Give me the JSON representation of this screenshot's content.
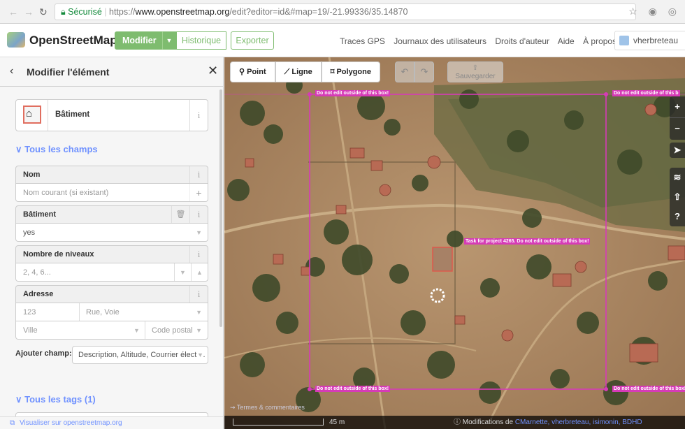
{
  "browser": {
    "security_label": "Sécurisé",
    "url_scheme": "https://",
    "url_host": "www.openstreetmap.org",
    "url_path": "/edit?editor=id&#map=19/-21.99336/35.14870"
  },
  "osm_header": {
    "brand": "OpenStreetMap",
    "modifier_label": "Modifier",
    "historique_label": "Historique",
    "exporter_label": "Exporter",
    "links": [
      "Traces GPS",
      "Journaux des utilisateurs",
      "Droits d'auteur",
      "Aide",
      "À propos"
    ],
    "username": "vherbreteau"
  },
  "panel": {
    "title": "Modifier l'élément",
    "preset_name": "Bâtiment",
    "section_fields": "Tous les champs",
    "fields": {
      "nom_label": "Nom",
      "nom_placeholder": "Nom courant (si existant)",
      "batiment_label": "Bâtiment",
      "batiment_value": "yes",
      "niveaux_label": "Nombre de niveaux",
      "niveaux_placeholder": "2, 4, 6...",
      "adresse_label": "Adresse",
      "adresse_number": "123",
      "adresse_street": "Rue, Voie",
      "adresse_city": "Ville",
      "adresse_postcode": "Code postal"
    },
    "add_field_label": "Ajouter champ:",
    "add_field_value": "Description, Altitude, Courrier électr...",
    "section_tags": "Tous les tags (1)",
    "footer_link": "Visualiser sur openstreetmap.org"
  },
  "map": {
    "toolbar": {
      "point": "Point",
      "ligne": "Ligne",
      "polygone": "Polygone",
      "save": "Sauvegarder"
    },
    "box_label": "Do not edit outside of this box!",
    "box_label_cut": "Do not edit outside of this b",
    "task_label": "Task for project 4265. Do not edit outside of this box!",
    "termes": "Termes & commentaires",
    "scale": "45 m",
    "credits_prefix": "Modifications de",
    "credits_users": "CMarnette, vherbreteau, isimonin, BDHD",
    "accent_color": "#d63bb7"
  }
}
